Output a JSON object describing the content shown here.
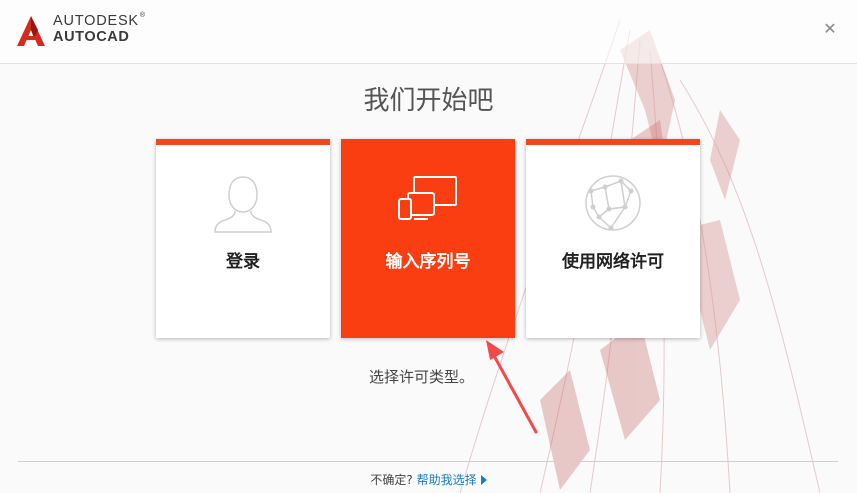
{
  "header": {
    "brand_line1": "AUTODESK",
    "brand_line1_mark": "®",
    "brand_line2": "AUTOCAD",
    "close_glyph": "✕"
  },
  "main": {
    "title": "我们开始吧",
    "subtitle": "选择许可类型。",
    "cards": [
      {
        "label": "登录",
        "icon": "user-silhouette-icon",
        "selected": false
      },
      {
        "label": "输入序列号",
        "icon": "devices-icon",
        "selected": true
      },
      {
        "label": "使用网络许可",
        "icon": "globe-network-icon",
        "selected": false
      }
    ]
  },
  "footer": {
    "question": "不确定?",
    "help_link": "帮助我选择"
  },
  "colors": {
    "accent": "#fa3e12",
    "card_topbar": "#f0471e",
    "link": "#1a7bc6",
    "annotation_arrow": "#f04a4a"
  }
}
